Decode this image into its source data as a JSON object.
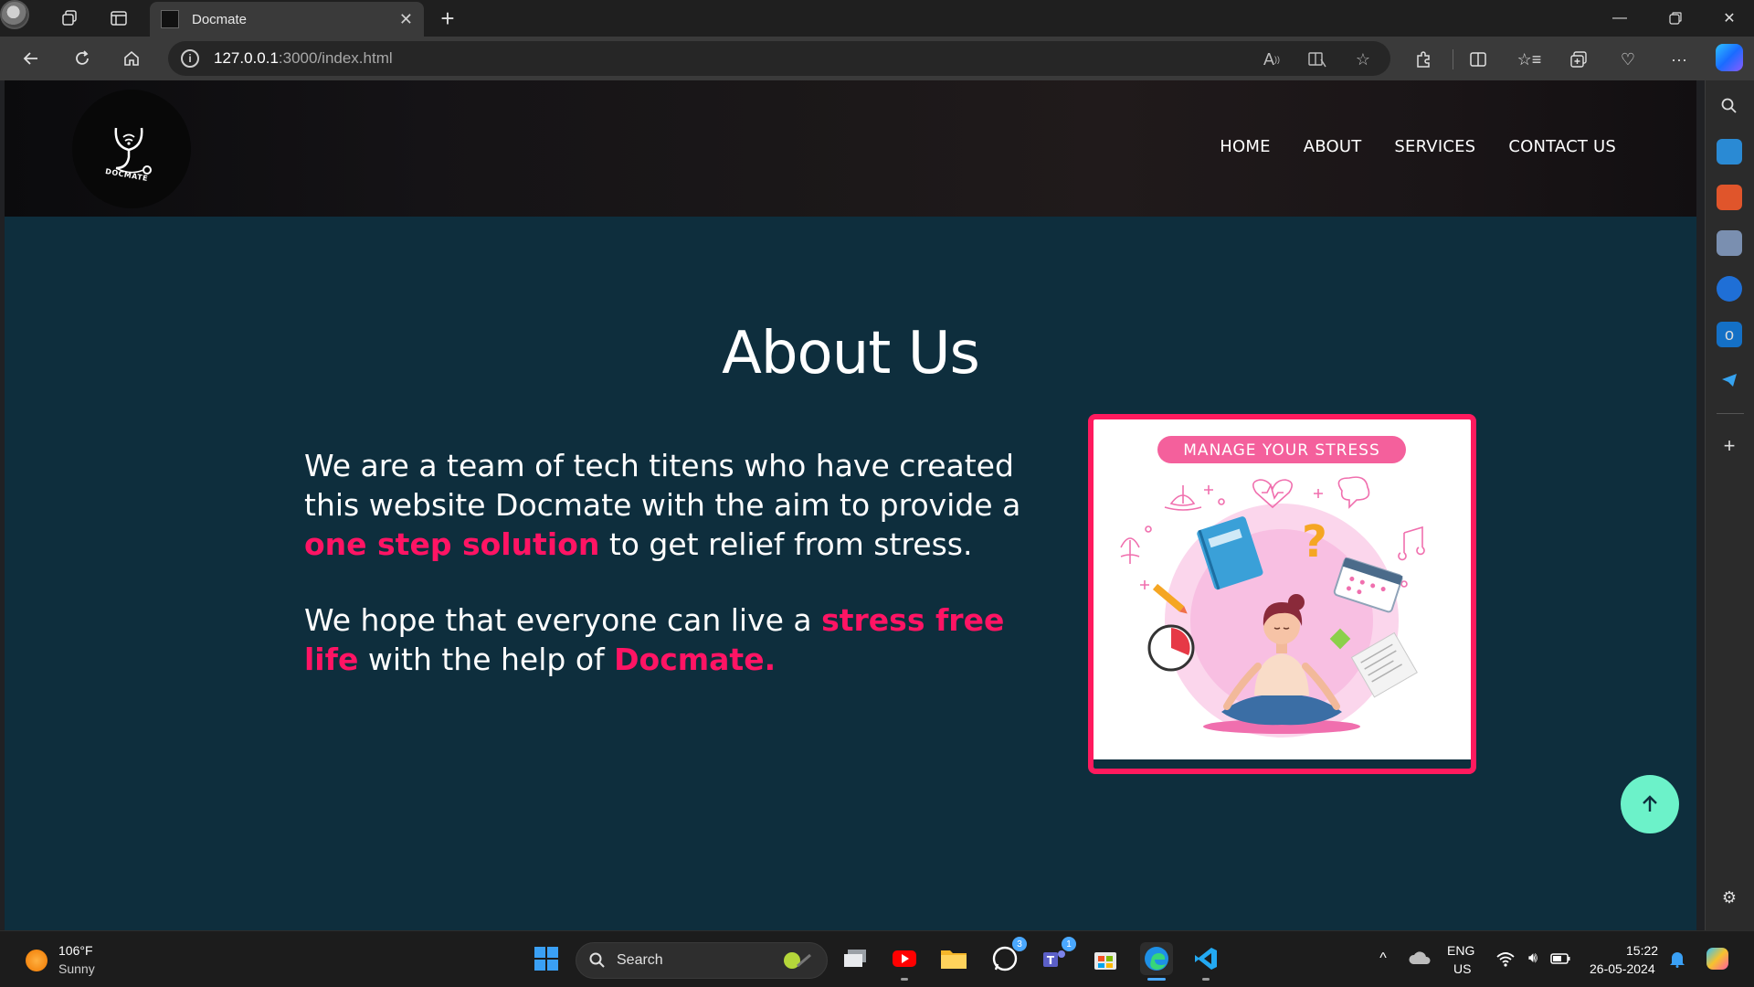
{
  "browser": {
    "tab_title": "Docmate",
    "url_host": "127.0.0.1",
    "url_path": ":3000/index.html"
  },
  "site": {
    "logo_text": "DOCMATE",
    "nav": [
      "HOME",
      "ABOUT",
      "SERVICES",
      "CONTACT US"
    ],
    "about": {
      "title": "About Us",
      "p1_a": "We are a team of tech titens who have created this website Docmate with the aim to provide a ",
      "p1_hl": "one step solution",
      "p1_b": " to get relief from stress.",
      "p2_a": "We hope that everyone can live a ",
      "p2_hl1": "stress free life",
      "p2_b": " with the help of ",
      "p2_hl2": "Docmate."
    },
    "image_banner": "MANAGE YOUR STRESS",
    "colors": {
      "accent": "#ff1464",
      "bg": "#0e2e3d",
      "scroll_btn": "#6cf2c9"
    }
  },
  "taskbar": {
    "weather_temp": "106°F",
    "weather_cond": "Sunny",
    "search_label": "Search",
    "whatsapp_badge": "3",
    "teams_badge": "1",
    "lang_top": "ENG",
    "lang_bottom": "US",
    "time": "15:22",
    "date": "26-05-2024"
  }
}
